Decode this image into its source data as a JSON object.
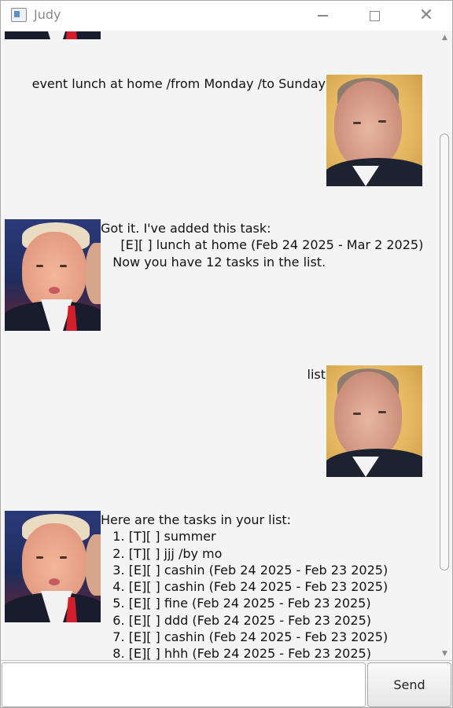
{
  "window": {
    "title": "Judy"
  },
  "messages": [
    {
      "sender": "user",
      "text": "event lunch at home /from Monday /to Sunday"
    },
    {
      "sender": "bot",
      "text": "Got it. I've added this task:\n     [E][ ] lunch at home (Feb 24 2025 - Mar 2 2025)\n   Now you have 12 tasks in the list."
    },
    {
      "sender": "user",
      "text": "list"
    },
    {
      "sender": "bot",
      "text": "Here are the tasks in your list:\n   1. [T][ ] summer\n   2. [T][ ] jjj /by mo\n   3. [E][ ] cashin (Feb 24 2025 - Feb 23 2025)\n   4. [E][ ] cashin (Feb 24 2025 - Feb 23 2025)\n   5. [E][ ] fine (Feb 24 2025 - Feb 23 2025)\n   6. [E][ ] ddd (Feb 24 2025 - Feb 23 2025)\n   7. [E][ ] cashin (Feb 24 2025 - Feb 23 2025)\n   8. [E][ ] hhh (Feb 24 2025 - Feb 23 2025)"
    }
  ],
  "input": {
    "value": "",
    "placeholder": ""
  },
  "send_button": {
    "label": "Send"
  },
  "icons": {
    "app": "window-app-icon",
    "minimize": "minimize-icon",
    "maximize": "maximize-icon",
    "close": "close-icon"
  }
}
